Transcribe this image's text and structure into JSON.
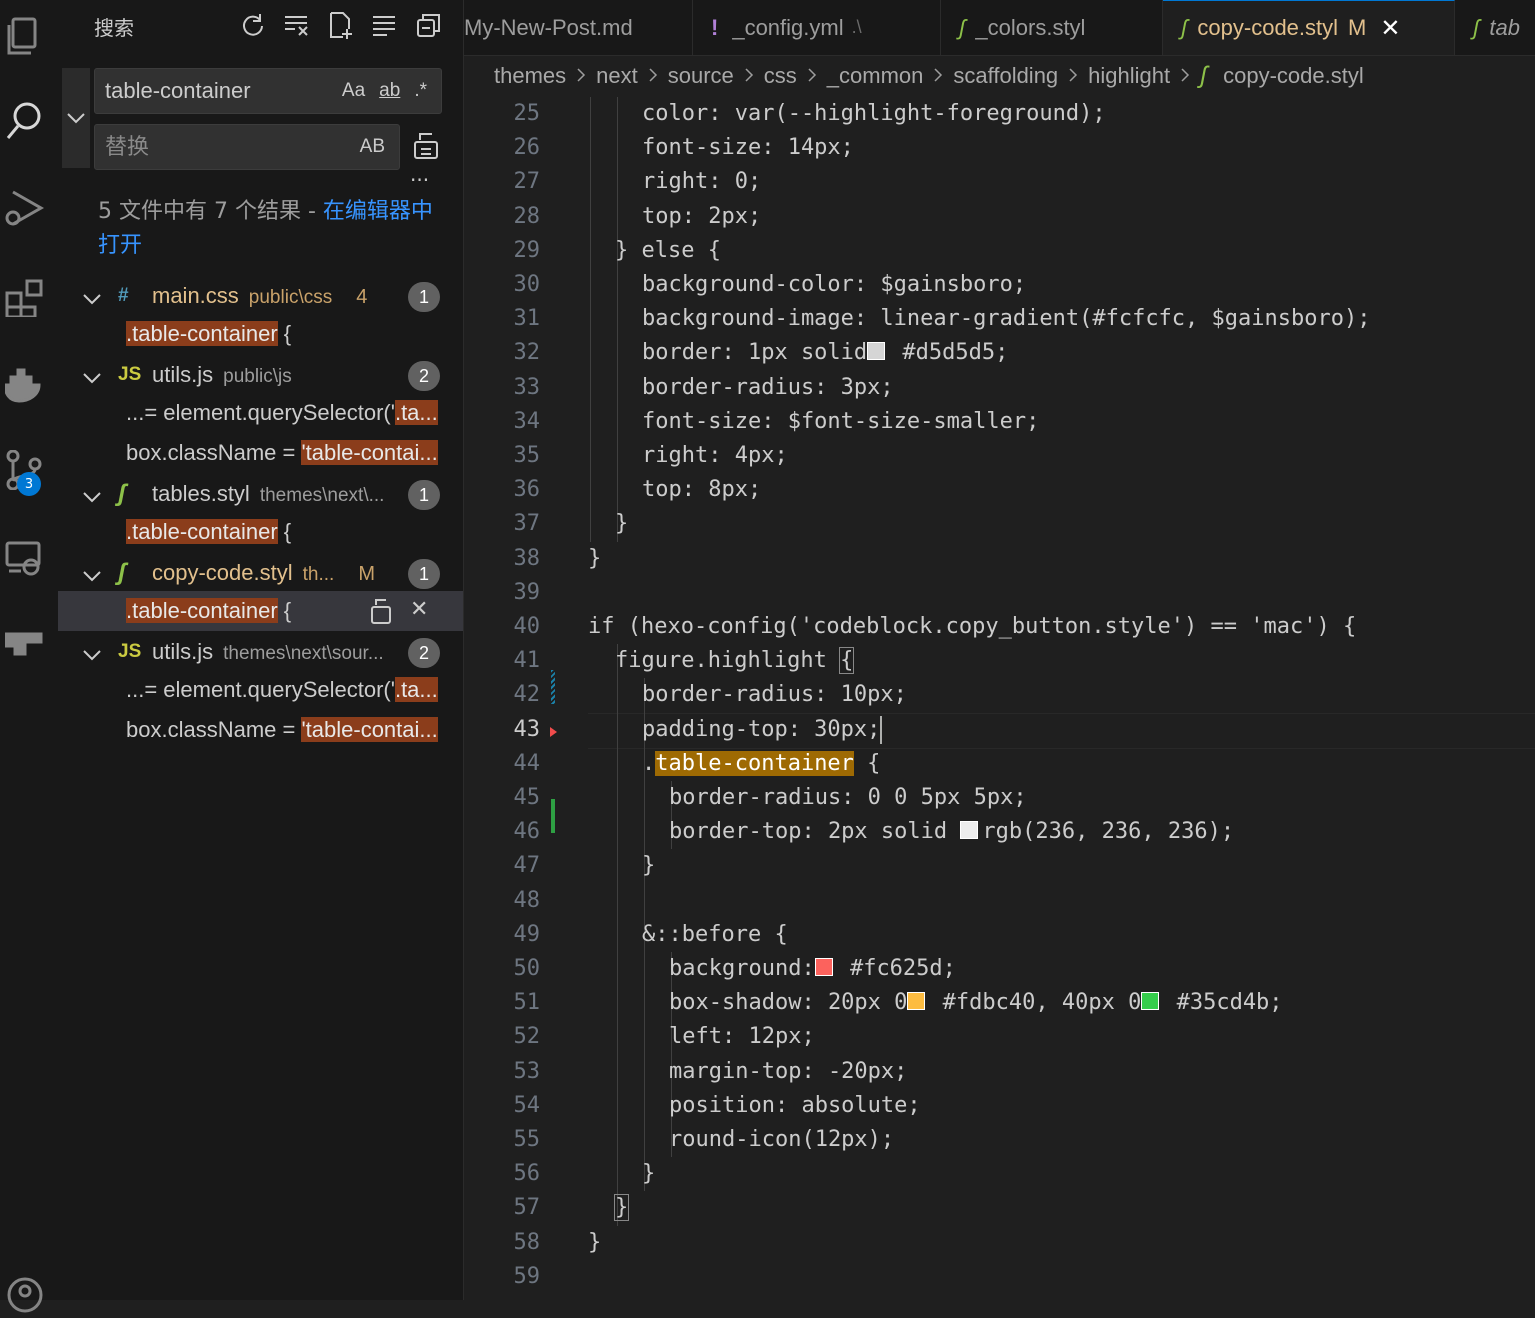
{
  "sidebar": {
    "title": "搜索",
    "search_value": "table-container",
    "search_opts": [
      "Aa",
      "ab",
      ".*"
    ],
    "replace_placeholder": "替换",
    "replace_opt": "AB",
    "more": "···",
    "summary_prefix": "5 文件中有 7 个结果 - ",
    "summary_link": "在编辑器中打开",
    "results": [
      {
        "icon": "#",
        "icon_color": "#519aba",
        "name": "main.css",
        "name_color": "#e2c08d",
        "path": "public\\css",
        "path_color": "#c9a26a",
        "mod": "4",
        "count": "1",
        "matches": [
          {
            "pre": "",
            "hl": ".table-container",
            "post": " {"
          }
        ]
      },
      {
        "icon": "JS",
        "icon_color": "#cbcb41",
        "name": "utils.js",
        "name_color": "#cccccc",
        "path": "public\\js",
        "path_color": "#9d9d9d",
        "mod": "",
        "count": "2",
        "matches": [
          {
            "pre": "...= element.querySelector('",
            "hl": ".ta...",
            "post": ""
          },
          {
            "pre": "box.className = ",
            "hl": "'table-contai...",
            "post": ""
          }
        ]
      },
      {
        "icon": "ʃ",
        "icon_color": "#8dc149",
        "name": "tables.styl",
        "name_color": "#cccccc",
        "path": "themes\\next\\...",
        "path_color": "#9d9d9d",
        "mod": "",
        "count": "1",
        "matches": [
          {
            "pre": "",
            "hl": ".table-container",
            "post": " {"
          }
        ]
      },
      {
        "icon": "ʃ",
        "icon_color": "#8dc149",
        "name": "copy-code.styl",
        "name_color": "#e2c08d",
        "path": "th...",
        "path_color": "#c9a26a",
        "mod": "M",
        "count": "1",
        "matches": [
          {
            "pre": "",
            "hl": ".table-container",
            "post": " {"
          }
        ]
      },
      {
        "icon": "JS",
        "icon_color": "#cbcb41",
        "name": "utils.js",
        "name_color": "#cccccc",
        "path": "themes\\next\\sour...",
        "path_color": "#9d9d9d",
        "mod": "",
        "count": "2",
        "matches": [
          {
            "pre": "...= element.querySelector('",
            "hl": ".ta...",
            "post": ""
          },
          {
            "pre": "box.className = ",
            "hl": "'table-contai...",
            "post": ""
          }
        ]
      }
    ],
    "scm_badge": "3"
  },
  "tabs": [
    {
      "icon": "",
      "label": "My-New-Post.md",
      "dim": "",
      "mod": "",
      "active": false
    },
    {
      "icon": "!",
      "label": "_config.yml",
      "dim": ".\\",
      "mod": "",
      "active": false
    },
    {
      "icon": "ʃ",
      "label": "_colors.styl",
      "dim": "",
      "mod": "",
      "active": false
    },
    {
      "icon": "ʃ",
      "label": "copy-code.styl",
      "dim": "",
      "mod": "M",
      "active": true
    },
    {
      "icon": "ʃ",
      "label": "tab",
      "dim": "",
      "mod": "",
      "active": false
    }
  ],
  "breadcrumbs": [
    "themes",
    "next",
    "source",
    "css",
    "_common",
    "scaffolding",
    "highlight",
    "copy-code.styl"
  ],
  "editor": {
    "current_line": 43,
    "lines": [
      {
        "n": 25,
        "i": 2,
        "t": "color: var(--highlight-foreground);"
      },
      {
        "n": 26,
        "i": 2,
        "t": "font-size: 14px;"
      },
      {
        "n": 27,
        "i": 2,
        "t": "right: 0;"
      },
      {
        "n": 28,
        "i": 2,
        "t": "top: 2px;"
      },
      {
        "n": 29,
        "i": 1,
        "t": "} else {"
      },
      {
        "n": 30,
        "i": 2,
        "t": "background-color: $gainsboro;"
      },
      {
        "n": 31,
        "i": 2,
        "t": "background-image: linear-gradient(#fcfcfc, $gainsboro);"
      },
      {
        "n": 32,
        "i": 2,
        "t": "border: 1px solid",
        "sw": "#d5d5d5",
        "t2": " #d5d5d5;"
      },
      {
        "n": 33,
        "i": 2,
        "t": "border-radius: 3px;"
      },
      {
        "n": 34,
        "i": 2,
        "t": "font-size: $font-size-smaller;"
      },
      {
        "n": 35,
        "i": 2,
        "t": "right: 4px;"
      },
      {
        "n": 36,
        "i": 2,
        "t": "top: 8px;"
      },
      {
        "n": 37,
        "i": 1,
        "t": "}"
      },
      {
        "n": 38,
        "i": 0,
        "t": "}"
      },
      {
        "n": 39,
        "i": 0,
        "t": ""
      },
      {
        "n": 40,
        "i": 0,
        "t": "if (hexo-config('codeblock.copy_button.style') == 'mac') {"
      },
      {
        "n": 41,
        "i": 1,
        "t": "figure.highlight ",
        "t2": "{"
      },
      {
        "n": 42,
        "i": 2,
        "t": "border-radius: 10px;"
      },
      {
        "n": 43,
        "i": 2,
        "t": "padding-top: 30px;"
      },
      {
        "n": 44,
        "i": 2,
        "pre": ".",
        "hl": "table-container",
        "t2": " {"
      },
      {
        "n": 45,
        "i": 3,
        "t": "border-radius: 0 0 5px 5px;"
      },
      {
        "n": 46,
        "i": 3,
        "t": "border-top: 2px solid ",
        "sw": "#ececec",
        "t2": "rgb(236, 236, 236);"
      },
      {
        "n": 47,
        "i": 2,
        "t": "}"
      },
      {
        "n": 48,
        "i": 0,
        "t": ""
      },
      {
        "n": 49,
        "i": 2,
        "t": "&::before {"
      },
      {
        "n": 50,
        "i": 3,
        "t": "background:",
        "sw": "#fc625d",
        "t2": " #fc625d;"
      },
      {
        "n": 51,
        "i": 3,
        "t": "box-shadow: 20px 0",
        "sw": "#fdbc40",
        "t2": " #fdbc40, 40px 0",
        "sw2": "#35cd4b",
        "t3": " #35cd4b;"
      },
      {
        "n": 52,
        "i": 3,
        "t": "left: 12px;"
      },
      {
        "n": 53,
        "i": 3,
        "t": "margin-top: -20px;"
      },
      {
        "n": 54,
        "i": 3,
        "t": "position: absolute;"
      },
      {
        "n": 55,
        "i": 3,
        "t": "round-icon(12px);"
      },
      {
        "n": 56,
        "i": 2,
        "t": "}"
      },
      {
        "n": 57,
        "i": 1,
        "t": "}"
      },
      {
        "n": 58,
        "i": 0,
        "t": "}"
      },
      {
        "n": 59,
        "i": 0,
        "t": ""
      }
    ]
  }
}
